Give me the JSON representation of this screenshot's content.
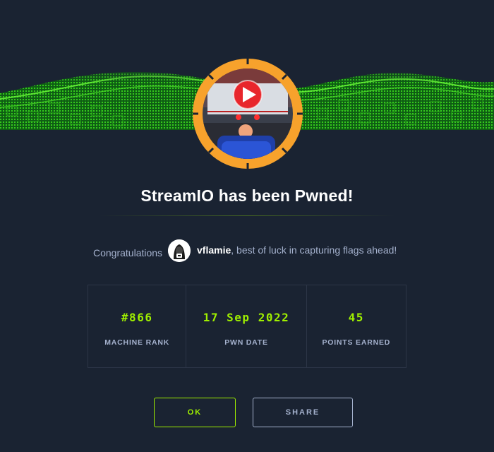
{
  "modal": {
    "title": "StreamIO has been Pwned!",
    "congrats_text": "Congratulations",
    "username": "vflamie",
    "user_suffix": ", best of luck in capturing flags ahead!",
    "stats": [
      {
        "value": "#866",
        "label": "MACHINE RANK"
      },
      {
        "value": "17 Sep 2022",
        "label": "PWN DATE"
      },
      {
        "value": "45",
        "label": "POINTS EARNED"
      }
    ],
    "buttons": {
      "ok_label": "OK",
      "share_label": "SHARE"
    }
  },
  "icons": {
    "badge": "machine-badge-icon",
    "avatar": "hacker-avatar-icon"
  },
  "colors": {
    "background": "#1a2332",
    "accent": "#9fef00",
    "muted": "#a4b1cd",
    "badge_ring": "#f7a22c",
    "border": "#2c3547"
  }
}
